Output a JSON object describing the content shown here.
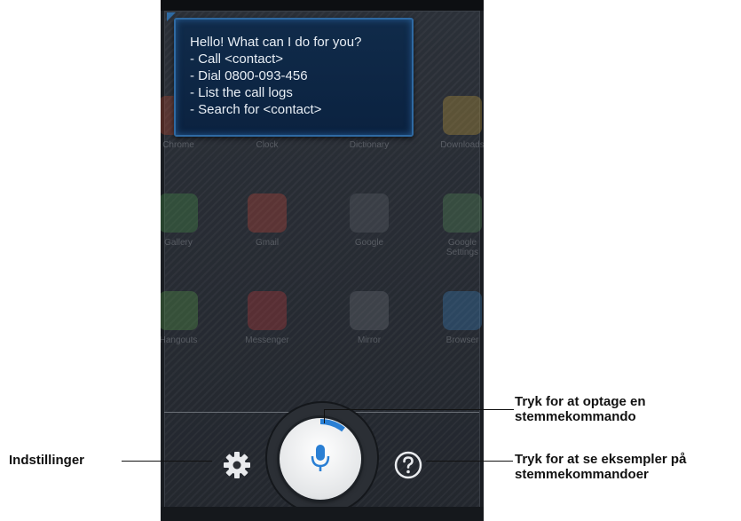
{
  "assistant_bubble": {
    "lines": [
      "Hello! What can I do for you?",
      "- Call <contact>",
      "- Dial 0800-093-456",
      "- List the call logs",
      "- Search for <contact>"
    ]
  },
  "background_apps": [
    {
      "label": "Chrome",
      "color": "#d44a2a"
    },
    {
      "label": "Clock",
      "color": "#d9d9d9"
    },
    {
      "label": "Dictionary",
      "color": "#c23b3b"
    },
    {
      "label": "Downloads",
      "color": "#e0b23a"
    },
    {
      "label": "Gallery",
      "color": "#4fa84f"
    },
    {
      "label": "Gmail",
      "color": "#e04a3a"
    },
    {
      "label": "Google",
      "color": "#6a6f76"
    },
    {
      "label": "Google Settings",
      "color": "#5f9f5f"
    },
    {
      "label": "Hangouts",
      "color": "#5fb14d"
    },
    {
      "label": "Messenger",
      "color": "#d83c3c"
    },
    {
      "label": "Mirror",
      "color": "#7a7f86"
    },
    {
      "label": "Browser",
      "color": "#3d8fd6"
    }
  ],
  "controls": {
    "settings_icon": "gear-icon",
    "mic_icon": "microphone-icon",
    "help_icon": "question-icon"
  },
  "colors": {
    "bubble_bg": "#0b2240",
    "bubble_border": "#2f6aa3",
    "mic_blue": "#2a7fd4"
  },
  "callouts": {
    "settings": "Indstillinger",
    "record_line1": "Tryk for at optage en",
    "record_line2": "stemmekommando",
    "examples_line1": "Tryk for at se eksempler på",
    "examples_line2": "stemmekommandoer"
  }
}
